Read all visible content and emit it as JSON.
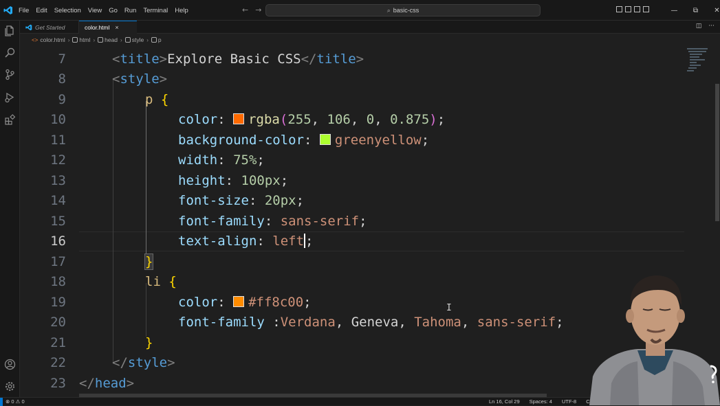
{
  "titlebar": {
    "menu": [
      "File",
      "Edit",
      "Selection",
      "View",
      "Go",
      "Run",
      "Terminal",
      "Help"
    ],
    "search_text": "basic-css",
    "controls": {
      "minimize": "—",
      "restore": "⧉",
      "close": "✕"
    }
  },
  "tabs": [
    {
      "label": "Get Started",
      "active": false
    },
    {
      "label": "color.html",
      "active": true,
      "close": "×"
    }
  ],
  "tab_actions": {
    "split": "◫",
    "more": "···"
  },
  "breadcrumb": [
    "color.html",
    "html",
    "head",
    "style",
    "p"
  ],
  "editor": {
    "current_line": 16,
    "line_numbers": [
      "7",
      "8",
      "9",
      "10",
      "11",
      "12",
      "13",
      "14",
      "15",
      "16",
      "17",
      "18",
      "19",
      "20",
      "21",
      "22",
      "23"
    ],
    "code": {
      "l7": {
        "open_tag": "title",
        "text": "Explore Basic CSS",
        "close_tag": "title"
      },
      "l8": {
        "tag": "style"
      },
      "l9": {
        "selector": "p",
        "brace": "{"
      },
      "l10": {
        "prop": "color",
        "fn": "rgba",
        "args": [
          "255",
          "106",
          "0",
          "0.875"
        ],
        "swatch": "#ff6a00"
      },
      "l11": {
        "prop": "background-color",
        "value": "greenyellow",
        "swatch": "#adff2f"
      },
      "l12": {
        "prop": "width",
        "value": "75%"
      },
      "l13": {
        "prop": "height",
        "value": "100px"
      },
      "l14": {
        "prop": "font-size",
        "value": "20px"
      },
      "l15": {
        "prop": "font-family",
        "value": "sans-serif"
      },
      "l16": {
        "prop": "text-align",
        "value": "left"
      },
      "l17": {
        "brace": "}"
      },
      "l18": {
        "selector": "li",
        "brace": "{"
      },
      "l19": {
        "prop": "color",
        "value": "#ff8c00",
        "swatch": "#ff8c00"
      },
      "l20": {
        "prop": "font-family",
        "fonts": [
          "Verdana",
          "Geneva",
          "Tahoma",
          "sans-serif"
        ]
      },
      "l21": {
        "brace": "}"
      },
      "l22": {
        "close_tag": "style"
      },
      "l23": {
        "close_tag": "head"
      }
    }
  },
  "statusbar": {
    "errors": "0",
    "warnings": "0",
    "position": "Ln 16, Col 29",
    "spaces": "Spaces: 4",
    "encoding": "UTF-8",
    "eol": "CF"
  },
  "colors": {
    "accent": "#0078d4",
    "editor_bg": "#1f1f1f",
    "chrome_bg": "#181818"
  }
}
